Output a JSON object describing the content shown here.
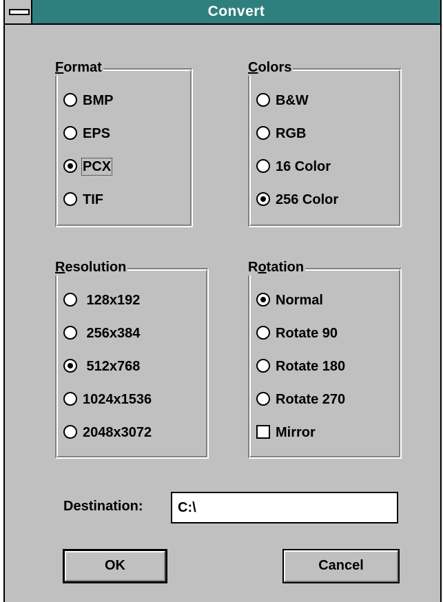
{
  "window": {
    "title": "Convert"
  },
  "format": {
    "label_mnemonic": "F",
    "label_rest": "ormat",
    "options": [
      "BMP",
      "EPS",
      "PCX",
      "TIF"
    ],
    "selected": "PCX"
  },
  "colors": {
    "label_mnemonic": "C",
    "label_rest": "olors",
    "options": [
      "B&W",
      "RGB",
      "16 Color",
      "256 Color"
    ],
    "selected": "256 Color"
  },
  "resolution": {
    "label_mnemonic": "R",
    "label_rest": "esolution",
    "options": [
      " 128x192",
      " 256x384",
      " 512x768",
      "1024x1536",
      "2048x3072"
    ],
    "selected": " 512x768"
  },
  "rotation": {
    "label_before": "R",
    "label_mnemonic": "o",
    "label_after": "tation",
    "options": [
      "Normal",
      "Rotate 90",
      "Rotate 180",
      "Rotate 270"
    ],
    "selected": "Normal",
    "mirror_label": "Mirror",
    "mirror_checked": false
  },
  "destination": {
    "label": "Destination:",
    "value": "C:\\"
  },
  "buttons": {
    "ok": "OK",
    "cancel": "Cancel"
  }
}
